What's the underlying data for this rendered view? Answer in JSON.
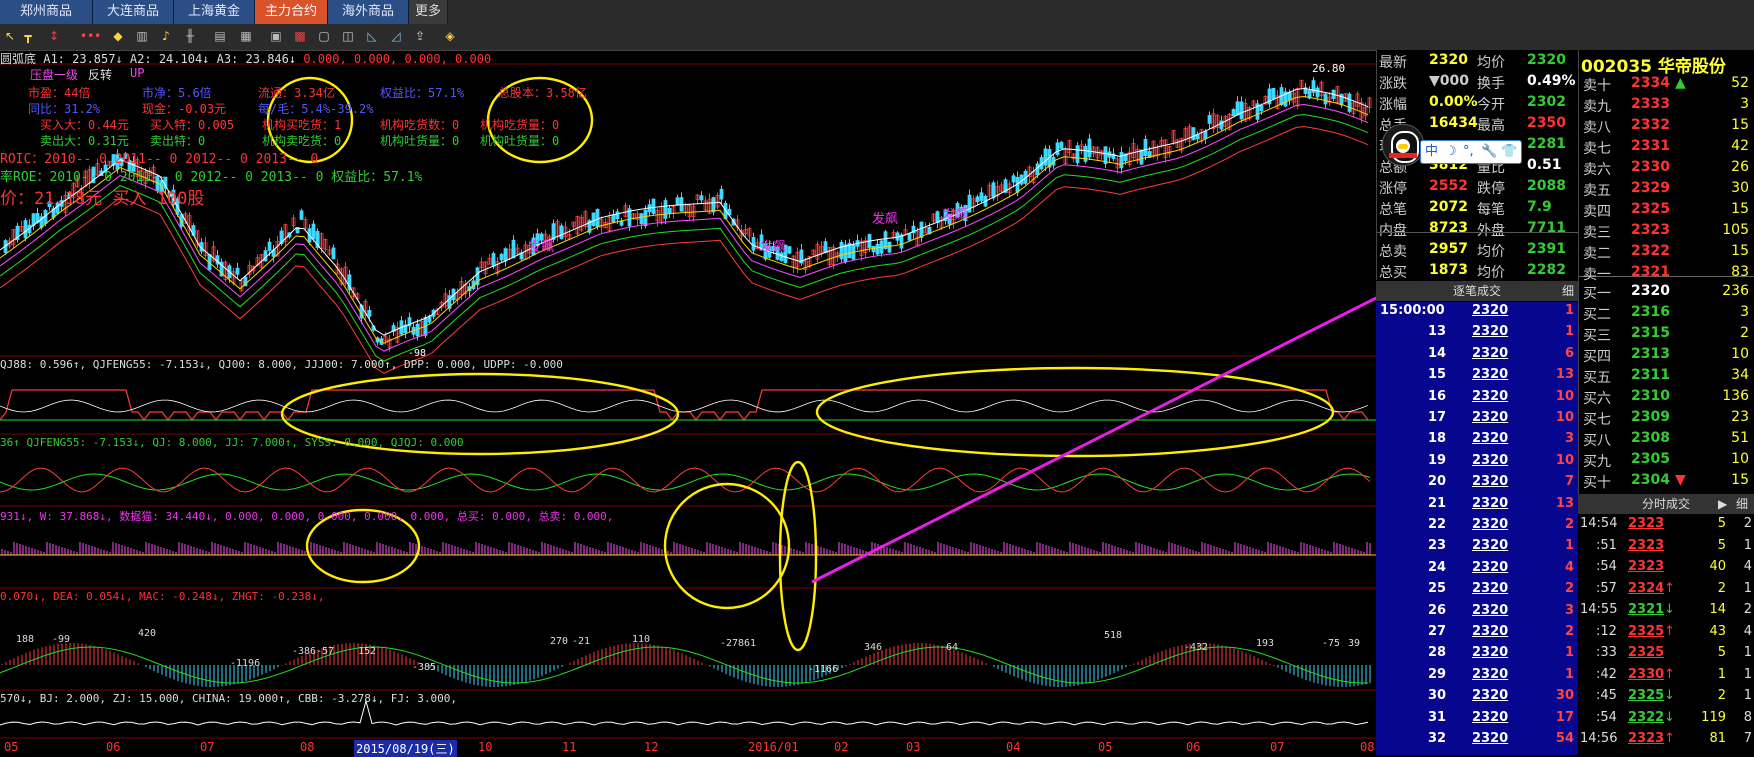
{
  "tabs": [
    {
      "label": "郑州商品",
      "active": false
    },
    {
      "label": "大连商品",
      "active": false
    },
    {
      "label": "上海黄金",
      "active": false
    },
    {
      "label": "主力合约",
      "active": true
    },
    {
      "label": "海外商品",
      "active": false
    },
    {
      "label": "更多",
      "active": false
    }
  ],
  "chart": {
    "ma_line": "圆弧底 A1: 23.857↓ A2: 24.104↓ A3: 23.846↓",
    "ma_line_extra": "0.000, 0.000, 0.000, 0.000",
    "top_tags": [
      "压盘一级",
      "反转",
      "UP"
    ],
    "info": {
      "pe_dynamic": "市盈：44倍",
      "pe_static": "市净：5.6倍",
      "circulation": "流通：3.34亿",
      "equity_ratio": "权益比：57.1%",
      "total_shares": "总股本：3.58亿",
      "yoy": "同比：31.2%",
      "cash": "现金：-0.03元",
      "per_share": "每/毛：5.4%-39.2%",
      "big_buy": "买入大：0.44元",
      "special_buy": "买入特：0.005",
      "inst_buy": "机构买吃货：1",
      "inst_eat": "机构吃货数：0",
      "inst_vol": "机构吃货量：0",
      "big_sell": "卖出大：0.31元",
      "special_sell": "卖出特：0",
      "inst_sell": "机构卖吃货：0",
      "inst_sell_vol": "机构吐货量：0",
      "inst_dump": "机构吐货量：0",
      "roic": "ROIC：2010-- 0   2011-- 0   2012-- 0   2013-- 0",
      "roe": "率ROE：2010-- 0   2011-- 0   2012-- 0   2013-- 0    权益比：57.1%",
      "price_note": "价：21.18元  买入 100股"
    },
    "peak_label": "26.80",
    "low_label": "-98",
    "signal_labels": [
      "发飙",
      "发飙",
      "发飙",
      "发飙"
    ],
    "sub1": "QJ88: 0.596↑, QJFENG55: -7.153↓, QJ00: 8.000, JJJ00: 7.000↑, DPP: 0.000, UDPP: -0.000",
    "sub2": "36↑ QJFENG55: -7.153↓, QJ: 8.000, JJ: 7.000↑, SYSS: 0.000, QJQJ: 0.000",
    "sub3": "931↓, W: 37.868↓, 数据猫: 34.440↓, 0.000, 0.000, 0.000, 0.000, 0.000, 总买: 0.000, 总卖: 0.000,",
    "sub4": "0.070↓, DEA: 0.054↓, MAC: -0.248↓, ZHGT: -0.238↓,",
    "macd_values": [
      "188",
      "-99",
      "420",
      "-1196",
      "-386",
      "-57",
      "152",
      "-385",
      "270",
      "-21",
      "110",
      "-278",
      "61",
      "-1166",
      "346",
      "-64",
      "518",
      "-432",
      "193",
      "-75",
      "39"
    ],
    "sub5": "570↓, BJ: 2.000, ZJ: 15.000, CHINA: 19.000↑, CBB: -3.278↓, FJ: 3.000,",
    "x_axis": [
      "05",
      "06",
      "07",
      "08",
      "2015/08/19(三)",
      "10",
      "11",
      "12",
      "2016/01",
      "02",
      "03",
      "04",
      "05",
      "06",
      "07",
      "08"
    ]
  },
  "quote": {
    "rows": [
      {
        "l": "最新",
        "v": "2320",
        "l2": "均价",
        "v2": "2320"
      },
      {
        "l": "涨跌",
        "v": "▼000",
        "l2": "换手",
        "v2": "0.49%"
      },
      {
        "l": "涨幅",
        "v": "0.00%",
        "l2": "今开",
        "v2": "2302"
      },
      {
        "l": "总手",
        "v": "16434",
        "l2": "最高",
        "v2": "2350"
      },
      {
        "l": "现手",
        "v": "",
        "l2": "",
        "v2": "2281"
      },
      {
        "l": "总额",
        "v": "3812",
        "l2": "量比",
        "v2": "0.51"
      },
      {
        "l": "涨停",
        "v": "2552",
        "l2": "跌停",
        "v2": "2088"
      },
      {
        "l": "总笔",
        "v": "2072",
        "l2": "每笔",
        "v2": "7.9"
      },
      {
        "l": "内盘",
        "v": "8723",
        "l2": "外盘",
        "v2": "7711"
      },
      {
        "l": "总卖",
        "v": "2957",
        "l2": "均价",
        "v2": "2391"
      },
      {
        "l": "总买",
        "v": "1873",
        "l2": "均价",
        "v2": "2282"
      }
    ],
    "trades_header": "逐笔成交",
    "trades_detail": "细"
  },
  "stock": {
    "code": "002035",
    "name": "华帝股份"
  },
  "ime": {
    "lang": "中",
    "moon": "☽",
    "dots": "°,",
    "wrench": "🔧",
    "shirt": "👕"
  },
  "book": {
    "sells": [
      {
        "l": "卖十",
        "p": "2334",
        "arrow": "▲",
        "q": "52"
      },
      {
        "l": "卖九",
        "p": "2333",
        "arrow": "",
        "q": "3"
      },
      {
        "l": "卖八",
        "p": "2332",
        "arrow": "",
        "q": "15"
      },
      {
        "l": "卖七",
        "p": "2331",
        "arrow": "",
        "q": "42"
      },
      {
        "l": "卖六",
        "p": "2330",
        "arrow": "",
        "q": "26"
      },
      {
        "l": "卖五",
        "p": "2329",
        "arrow": "",
        "q": "30"
      },
      {
        "l": "卖四",
        "p": "2325",
        "arrow": "",
        "q": "15"
      },
      {
        "l": "卖三",
        "p": "2323",
        "arrow": "",
        "q": "105"
      },
      {
        "l": "卖二",
        "p": "2322",
        "arrow": "",
        "q": "15"
      },
      {
        "l": "卖一",
        "p": "2321",
        "arrow": "",
        "q": "83"
      }
    ],
    "buys": [
      {
        "l": "买一",
        "p": "2320",
        "arrow": "",
        "q": "236"
      },
      {
        "l": "买二",
        "p": "2316",
        "arrow": "",
        "q": "3"
      },
      {
        "l": "买三",
        "p": "2315",
        "arrow": "",
        "q": "2"
      },
      {
        "l": "买四",
        "p": "2313",
        "arrow": "",
        "q": "10"
      },
      {
        "l": "买五",
        "p": "2311",
        "arrow": "",
        "q": "34"
      },
      {
        "l": "买六",
        "p": "2310",
        "arrow": "",
        "q": "136"
      },
      {
        "l": "买七",
        "p": "2309",
        "arrow": "",
        "q": "23"
      },
      {
        "l": "买八",
        "p": "2308",
        "arrow": "",
        "q": "51"
      },
      {
        "l": "买九",
        "p": "2305",
        "arrow": "",
        "q": "10"
      },
      {
        "l": "买十",
        "p": "2304",
        "arrow": "▼",
        "q": "15"
      }
    ]
  },
  "trades": [
    {
      "t": "15:00:00",
      "p": "2320",
      "v": "1"
    },
    {
      "t": "13",
      "p": "2320",
      "v": "1"
    },
    {
      "t": "14",
      "p": "2320",
      "v": "6"
    },
    {
      "t": "15",
      "p": "2320",
      "v": "13"
    },
    {
      "t": "16",
      "p": "2320",
      "v": "10"
    },
    {
      "t": "17",
      "p": "2320",
      "v": "10"
    },
    {
      "t": "18",
      "p": "2320",
      "v": "3"
    },
    {
      "t": "19",
      "p": "2320",
      "v": "10"
    },
    {
      "t": "20",
      "p": "2320",
      "v": "7"
    },
    {
      "t": "21",
      "p": "2320",
      "v": "13"
    },
    {
      "t": "22",
      "p": "2320",
      "v": "2"
    },
    {
      "t": "23",
      "p": "2320",
      "v": "1"
    },
    {
      "t": "24",
      "p": "2320",
      "v": "4"
    },
    {
      "t": "25",
      "p": "2320",
      "v": "2"
    },
    {
      "t": "26",
      "p": "2320",
      "v": "3"
    },
    {
      "t": "27",
      "p": "2320",
      "v": "2"
    },
    {
      "t": "28",
      "p": "2320",
      "v": "1"
    },
    {
      "t": "29",
      "p": "2320",
      "v": "1"
    },
    {
      "t": "30",
      "p": "2320",
      "v": "30"
    },
    {
      "t": "31",
      "p": "2320",
      "v": "17"
    },
    {
      "t": "32",
      "p": "2320",
      "v": "54"
    }
  ],
  "ticks_header": "分时成交",
  "ticks_detail": "细",
  "ticks": [
    {
      "t": "14:54",
      "p": "2323",
      "a": "",
      "v": "5",
      "n": "2"
    },
    {
      "t": ":51",
      "p": "2323",
      "a": "",
      "v": "5",
      "n": "1"
    },
    {
      "t": ":54",
      "p": "2323",
      "a": "",
      "v": "40",
      "n": "4"
    },
    {
      "t": ":57",
      "p": "2324",
      "a": "↑",
      "v": "2",
      "n": "1"
    },
    {
      "t": "14:55",
      "p": "2321",
      "a": "↓",
      "v": "14",
      "n": "2"
    },
    {
      "t": ":12",
      "p": "2325",
      "a": "↑",
      "v": "43",
      "n": "4"
    },
    {
      "t": ":33",
      "p": "2325",
      "a": "",
      "v": "5",
      "n": "1"
    },
    {
      "t": ":42",
      "p": "2330",
      "a": "↑",
      "v": "1",
      "n": "1"
    },
    {
      "t": ":45",
      "p": "2325",
      "a": "↓",
      "v": "2",
      "n": "1"
    },
    {
      "t": ":54",
      "p": "2322",
      "a": "↓",
      "v": "119",
      "n": "8"
    },
    {
      "t": "14:56",
      "p": "2323",
      "a": "↑",
      "v": "81",
      "n": "7"
    }
  ]
}
